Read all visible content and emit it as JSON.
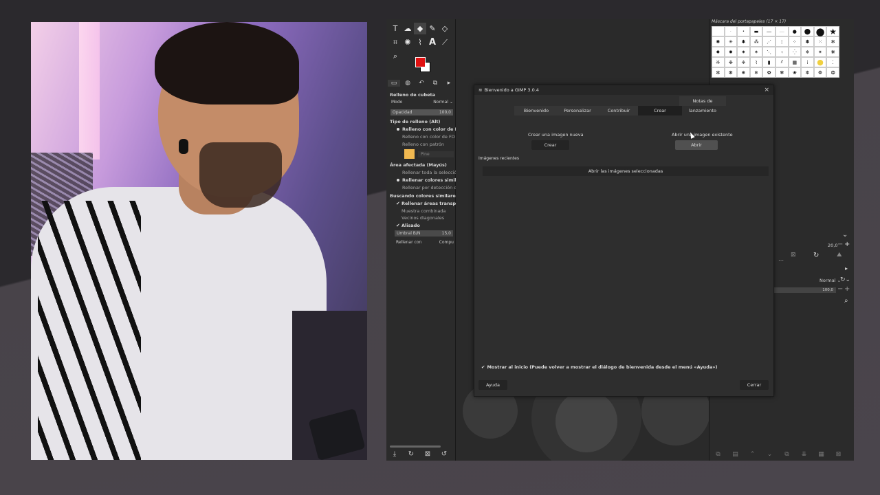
{
  "dialog": {
    "title": "Bienvenido a GIMP 3.0.4",
    "close": "×",
    "tabs": [
      "Bienvenido",
      "Personalizar",
      "Contribuir",
      "Crear",
      "Notas de lanzamiento"
    ],
    "active_tab": "Crear",
    "create_label": "Crear una imagen nueva",
    "create_button": "Crear",
    "open_label": "Abrir una imagen existente",
    "open_button": "Abrir",
    "recent_label": "Imágenes recientes",
    "recent_button": "Abrir las imágenes seleccionadas",
    "show_startup": "Mostrar al inicio (Puede volver a mostrar el diálogo de bienvenida desde el menú «Ayuda»)",
    "help_button": "Ayuda",
    "close_button": "Cerrar"
  },
  "tool_options": {
    "title": "Relleno de cubeta",
    "mode_label": "Modo",
    "mode_value": "Normal",
    "opacity_label": "Opacidad",
    "opacity_value": "100,0",
    "fill_type_label": "Tipo de relleno (Alt)",
    "fill_fg": "Relleno con color de PP",
    "fill_bg": "Relleno con color de FD",
    "fill_pattern": "Relleno con patrón",
    "pattern_name": "Pine",
    "affected_label": "Área afectada (Mayús)",
    "fill_selection": "Rellenar toda la selección",
    "fill_similar": "Rellenar colores similares",
    "fill_line_art": "Rellenar por detección de ar",
    "similar_label": "Buscando colores similares",
    "fill_transparent": "Rellenar áreas transparente",
    "sample_merged": "Muestra combinada",
    "diagonal": "Vecinos diagonales",
    "antialias": "Alisado",
    "threshold_label": "Umbral B/N",
    "threshold_value": "15,0",
    "fill_by_label": "Rellenar con",
    "fill_by_value": "Compu"
  },
  "brushes": {
    "title": "Máscara del portapapeles (17 × 17)"
  },
  "layers": {
    "size_value": "20,0",
    "mode_value": "Normal",
    "opacity_value": "100,0"
  },
  "colors": {
    "foreground": "#e01010",
    "background": "#ffffff"
  }
}
